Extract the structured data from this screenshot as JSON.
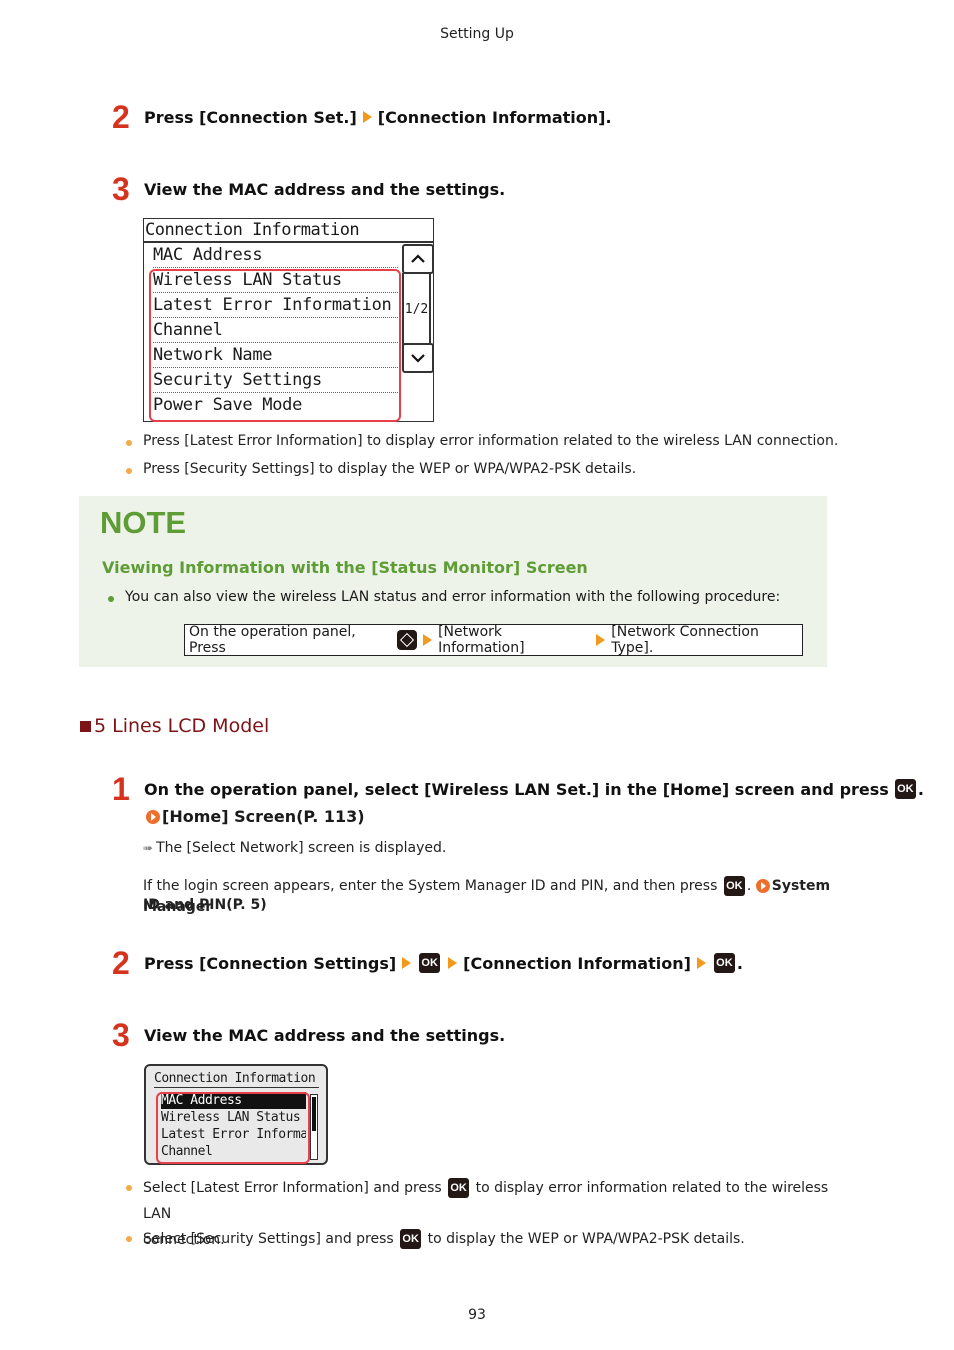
{
  "header": {
    "title": "Setting Up"
  },
  "touch_section": {
    "step2": {
      "number": "2",
      "part1": "Press [Connection Set.]",
      "part2": "[Connection Information]."
    },
    "step3": {
      "number": "3",
      "text": "View the MAC address and the settings."
    },
    "lcd": {
      "title": "Connection Information",
      "rows": [
        "MAC Address",
        "Wireless LAN Status",
        "Latest Error Information",
        "Channel",
        "Network Name",
        "Security Settings",
        "Power Save Mode"
      ],
      "page_indicator": "1/2",
      "highlighted_rows": [
        "Wireless LAN Status",
        "Latest Error Information",
        "Channel",
        "Network Name",
        "Security Settings",
        "Power Save Mode"
      ]
    },
    "bullets": [
      "Press [Latest Error Information] to display error information related to the wireless LAN connection.",
      "Press [Security Settings] to display the WEP or WPA/WPA2-PSK details."
    ]
  },
  "note": {
    "title": "NOTE",
    "subtitle": "Viewing Information with the [Status Monitor] Screen",
    "bullet": "You can also view the wireless LAN status and error information with the following procedure:",
    "procedure": {
      "prefix": "On the operation panel, Press",
      "part1": "[Network Information]",
      "part2": "[Network Connection Type]."
    }
  },
  "lcd5_section": {
    "heading": "5 Lines LCD Model",
    "step1": {
      "number": "1",
      "text": "On the operation panel, select [Wireless LAN Set.] in the [Home] screen and press",
      "end": ".",
      "link": "[Home] Screen(P. 113)",
      "result": "The [Select Network] screen is displayed.",
      "login_text": "If the login screen appears, enter the System Manager ID and PIN, and then press",
      "login_sep": ".",
      "login_link_1": "System Manager",
      "login_link_2": "ID and PIN(P. 5)"
    },
    "step2": {
      "number": "2",
      "part1": "Press [Connection Settings]",
      "part2": "[Connection Information]",
      "end": "."
    },
    "step3": {
      "number": "3",
      "text": "View the MAC address and the settings."
    },
    "lcd": {
      "title": "Connection Information",
      "rows": [
        "MAC Address",
        "Wireless LAN Status",
        "Latest Error Informa",
        "Channel"
      ],
      "selected_row": "MAC Address"
    },
    "bullets": [
      {
        "before": "Select [Latest Error Information] and press",
        "after": "to display error information related to the wireless LAN",
        "cont": "connection."
      },
      {
        "before": "Select [Security Settings] and press",
        "after": "to display the WEP or WPA/WPA2-PSK details."
      }
    ]
  },
  "ok_label": "OK",
  "footer": {
    "page_number": "93"
  }
}
